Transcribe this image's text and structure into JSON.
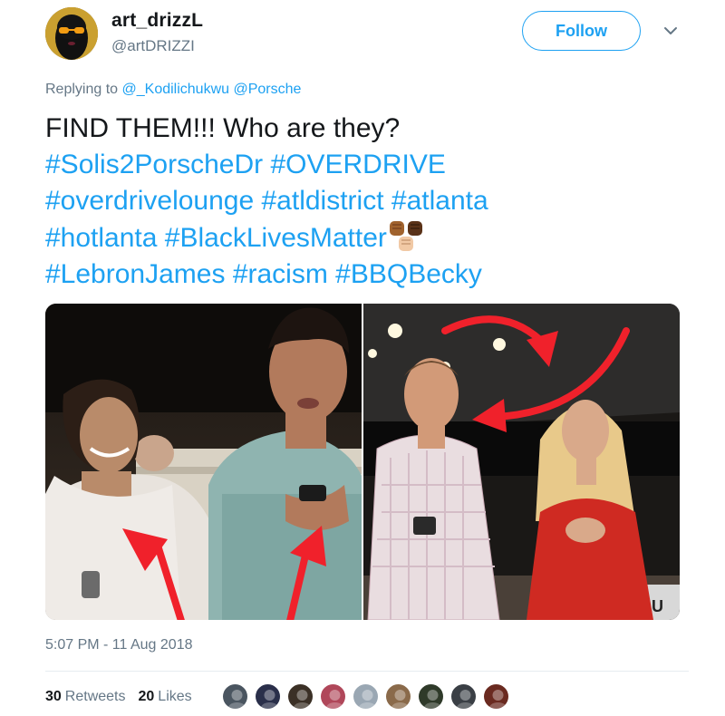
{
  "author": {
    "name": "art_drizzL",
    "handle": "@artDRIZZI",
    "follow_label": "Follow"
  },
  "reply_context": {
    "prefix": "Replying to",
    "mentions": [
      "@_Kodilichukwu",
      "@Porsche"
    ]
  },
  "tweet": {
    "lines": [
      [
        {
          "text": "FIND THEM!!!  Who are they?",
          "kind": "plain"
        }
      ],
      [
        {
          "text": "#Solis2PorscheDr",
          "kind": "hashtag"
        },
        {
          "text": " ",
          "kind": "plain"
        },
        {
          "text": "#OVERDRIVE",
          "kind": "hashtag"
        }
      ],
      [
        {
          "text": "#overdrivelounge",
          "kind": "hashtag"
        },
        {
          "text": " ",
          "kind": "plain"
        },
        {
          "text": "#atldistrict",
          "kind": "hashtag"
        },
        {
          "text": " ",
          "kind": "plain"
        },
        {
          "text": "#atlanta",
          "kind": "hashtag"
        }
      ],
      [
        {
          "text": "#hotlanta",
          "kind": "hashtag"
        },
        {
          "text": " ",
          "kind": "plain"
        },
        {
          "text": "#BlackLivesMatter",
          "kind": "hashtag"
        },
        {
          "text": "",
          "kind": "emoji"
        }
      ],
      [
        {
          "text": "#LebronJames",
          "kind": "hashtag"
        },
        {
          "text": " ",
          "kind": "plain"
        },
        {
          "text": "#racism",
          "kind": "hashtag"
        },
        {
          "text": " ",
          "kind": "plain"
        },
        {
          "text": "#BBQBecky",
          "kind": "hashtag"
        }
      ]
    ],
    "emoji_name": "raised-fist-emoji-group"
  },
  "media": {
    "photos": [
      {
        "name": "photo-left"
      },
      {
        "name": "photo-right",
        "sign_text": "U"
      }
    ]
  },
  "timestamp": "5:07 PM - 11 Aug 2018",
  "stats": {
    "retweets_count": "30",
    "retweets_label": "Retweets",
    "likes_count": "20",
    "likes_label": "Likes"
  },
  "likers": [
    {
      "color": "#4a5560"
    },
    {
      "color": "#2a2f4a"
    },
    {
      "color": "#3b3026"
    },
    {
      "color": "#b0475a"
    },
    {
      "color": "#9aa7b3"
    },
    {
      "color": "#8a6a4a"
    },
    {
      "color": "#2f3a2a"
    },
    {
      "color": "#3a3f45"
    },
    {
      "color": "#6a2a20"
    }
  ],
  "colors": {
    "link": "#1da1f2",
    "text": "#14171a",
    "muted": "#657786",
    "arrow": "#f0212b"
  }
}
